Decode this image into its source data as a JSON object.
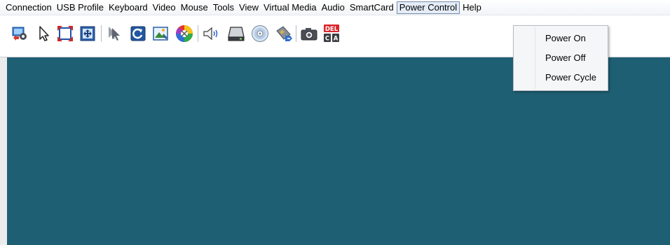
{
  "menubar": {
    "items": [
      {
        "label": "Connection"
      },
      {
        "label": "USB Profile"
      },
      {
        "label": "Keyboard"
      },
      {
        "label": "Video"
      },
      {
        "label": "Mouse"
      },
      {
        "label": "Tools"
      },
      {
        "label": "View"
      },
      {
        "label": "Virtual Media"
      },
      {
        "label": "Audio"
      },
      {
        "label": "SmartCard"
      },
      {
        "label": "Power Control"
      },
      {
        "label": "Help"
      }
    ],
    "active_item": "Power Control"
  },
  "toolbar": {
    "buttons": [
      {
        "icon": "settings-monitor-icon"
      },
      {
        "icon": "pointer-icon"
      },
      {
        "icon": "fullscreen-icon"
      },
      {
        "icon": "fit-window-icon"
      },
      {
        "icon": "dual-cursor-icon"
      },
      {
        "icon": "refresh-icon"
      },
      {
        "icon": "auto-adjust-icon"
      },
      {
        "icon": "color-wheel-icon"
      },
      {
        "icon": "speaker-icon"
      },
      {
        "icon": "drive-icon"
      },
      {
        "icon": "cd-icon"
      },
      {
        "icon": "smartcard-icon"
      },
      {
        "icon": "camera-icon"
      },
      {
        "icon": "ctrl-alt-del-icon"
      }
    ],
    "ctrl_alt_del": {
      "top": "DEL",
      "left": "C",
      "right": "A"
    }
  },
  "power_menu": {
    "items": [
      {
        "label": "Power On"
      },
      {
        "label": "Power Off"
      },
      {
        "label": "Power Cycle"
      }
    ]
  },
  "colors": {
    "remote_screen": "#1f5f74",
    "menu_highlight_border": "#7a8ba8",
    "del_red": "#d9252b"
  }
}
